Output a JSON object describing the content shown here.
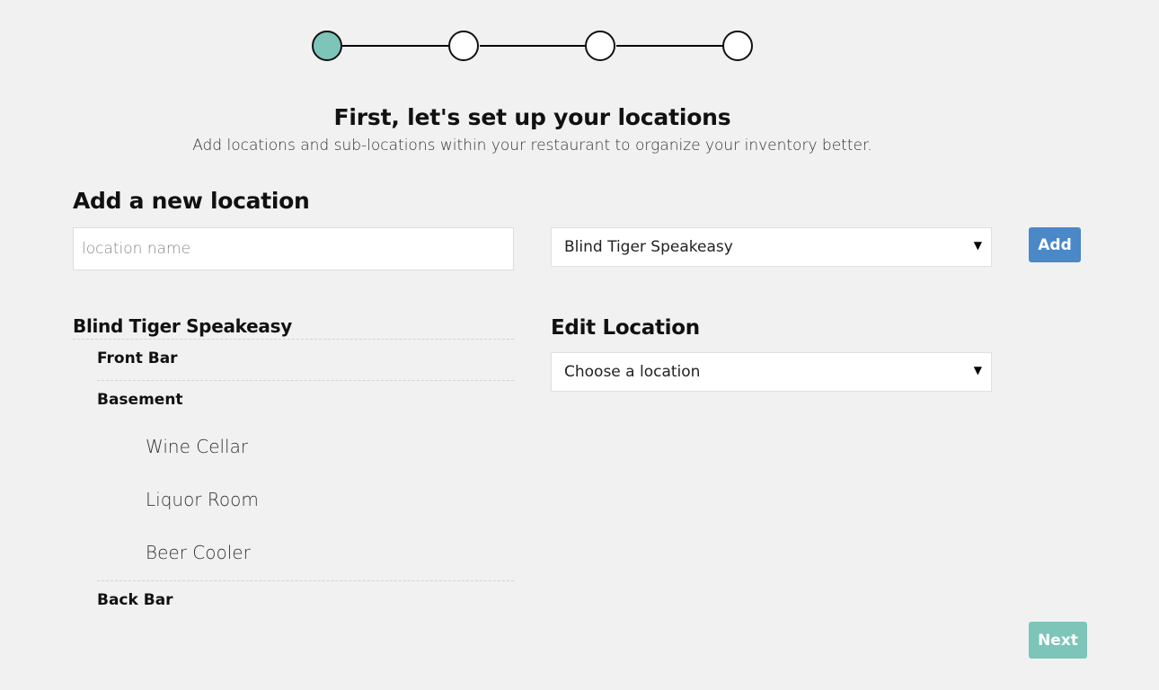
{
  "stepper": {
    "steps": 4,
    "current_step": 1,
    "active_color": "#7cc5b8"
  },
  "header": {
    "title": "First, let's set up your locations",
    "subtitle": "Add locations and sub-locations within your restaurant to organize your inventory better."
  },
  "add_location": {
    "title": "Add a new location",
    "name_placeholder": "location name",
    "parent_select_value": "Blind Tiger Speakeasy",
    "add_label": "Add",
    "add_color": "#4a88c8"
  },
  "tree": {
    "root": "Blind Tiger Speakeasy",
    "items": [
      {
        "label": "Front Bar"
      },
      {
        "label": "Basement",
        "children": [
          "Wine Cellar",
          "Liquor Room",
          "Beer Cooler"
        ]
      },
      {
        "label": "Back Bar"
      }
    ]
  },
  "edit_location": {
    "title": "Edit Location",
    "select_value": "Choose a location"
  },
  "footer": {
    "next_label": "Next",
    "next_color": "#7cc5b8"
  },
  "icons": {
    "select_caret": "caret-down-icon"
  }
}
